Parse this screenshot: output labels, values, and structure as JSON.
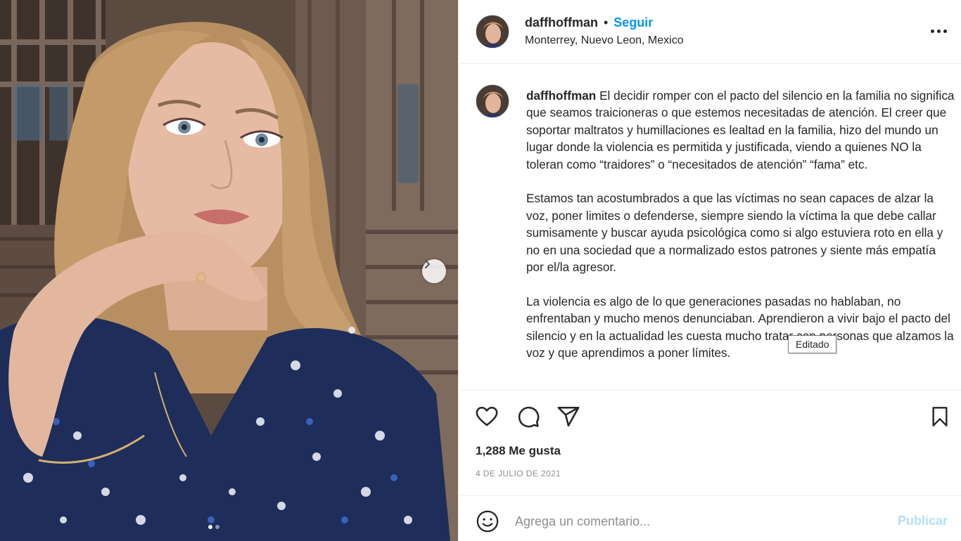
{
  "post": {
    "username": "daffhoffman",
    "bullet": "•",
    "follow_label": "Seguir",
    "location": "Monterrey, Nuevo Leon, Mexico",
    "more_icon": "more-horizontal-icon"
  },
  "caption": {
    "username": "daffhoffman",
    "text": " El decidir romper con el pacto del silencio en la familia no significa que seamos traicioneras o que estemos necesitadas de atención. El creer que soportar maltratos y humillaciones es lealtad en la familia, hizo del mundo un lugar donde la violencia es permitida y justificada, viendo a quienes NO la toleran como “traidores” o “necesitados de atención” “fama” etc.\n\nEstamos tan acostumbrados a que las víctimas no sean capaces de alzar la voz, poner limites o defenderse, siempre siendo la víctima la que debe callar sumisamente y buscar ayuda psicológica como si algo estuviera roto en ella y no en una sociedad que a normalizado estos patrones y siente más empatía por el/la agresor.\n\nLa violencia es algo de lo que generaciones pasadas no hablaban, no enfrentaban y mucho menos denunciaban. Aprendieron a vivir bajo el pacto del silencio y en la actualidad les cuesta mucho tratar con personas que alzamos la voz y que aprendimos a poner límites.",
    "tooltip": "Editado"
  },
  "stats": {
    "likes": "1,288 Me gusta",
    "date": "4 DE JULIO DE 2021"
  },
  "comment": {
    "placeholder": "Agrega un comentario...",
    "publish_label": "Publicar"
  },
  "carousel": {
    "total_slides": 2,
    "active_slide": 1
  },
  "colors": {
    "accent": "#0095f6",
    "publish_disabled": "#b2dffc",
    "muted": "#8e8e8e",
    "text": "#262626"
  }
}
